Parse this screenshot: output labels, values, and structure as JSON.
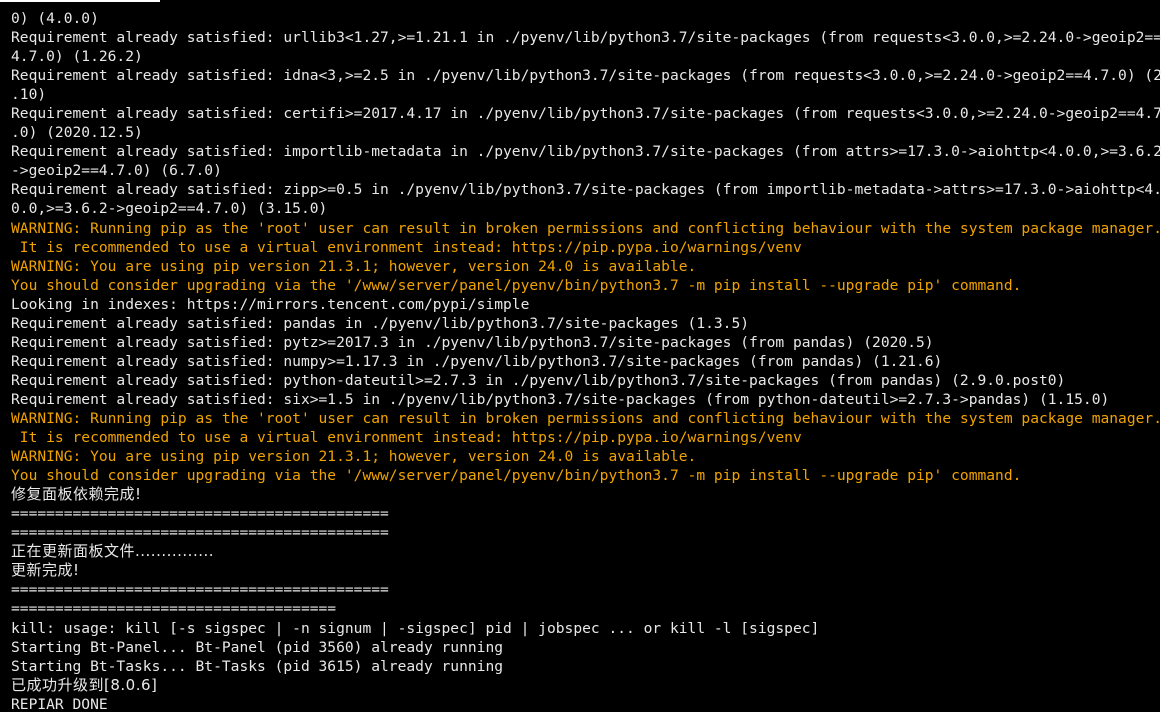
{
  "terminal": {
    "colors": {
      "background": "#000000",
      "text": "#e8e8e8",
      "warning": "#f0a300"
    },
    "lines": [
      {
        "text": "0) (4.0.0)",
        "kind": "normal"
      },
      {
        "text": "Requirement already satisfied: urllib3<1.27,>=1.21.1 in ./pyenv/lib/python3.7/site-packages (from requests<3.0.0,>=2.24.0->geoip2==",
        "kind": "normal"
      },
      {
        "text": "4.7.0) (1.26.2)",
        "kind": "normal"
      },
      {
        "text": "Requirement already satisfied: idna<3,>=2.5 in ./pyenv/lib/python3.7/site-packages (from requests<3.0.0,>=2.24.0->geoip2==4.7.0) (2",
        "kind": "normal"
      },
      {
        "text": ".10)",
        "kind": "normal"
      },
      {
        "text": "Requirement already satisfied: certifi>=2017.4.17 in ./pyenv/lib/python3.7/site-packages (from requests<3.0.0,>=2.24.0->geoip2==4.7",
        "kind": "normal"
      },
      {
        "text": ".0) (2020.12.5)",
        "kind": "normal"
      },
      {
        "text": "Requirement already satisfied: importlib-metadata in ./pyenv/lib/python3.7/site-packages (from attrs>=17.3.0->aiohttp<4.0.0,>=3.6.2",
        "kind": "normal"
      },
      {
        "text": "->geoip2==4.7.0) (6.7.0)",
        "kind": "normal"
      },
      {
        "text": "Requirement already satisfied: zipp>=0.5 in ./pyenv/lib/python3.7/site-packages (from importlib-metadata->attrs>=17.3.0->aiohttp<4.",
        "kind": "normal"
      },
      {
        "text": "0.0,>=3.6.2->geoip2==4.7.0) (3.15.0)",
        "kind": "normal"
      },
      {
        "text": "WARNING: Running pip as the 'root' user can result in broken permissions and conflicting behaviour with the system package manager.",
        "kind": "warn"
      },
      {
        "text": " It is recommended to use a virtual environment instead: https://pip.pypa.io/warnings/venv",
        "kind": "warn"
      },
      {
        "text": "WARNING: You are using pip version 21.3.1; however, version 24.0 is available.",
        "kind": "warn"
      },
      {
        "text": "You should consider upgrading via the '/www/server/panel/pyenv/bin/python3.7 -m pip install --upgrade pip' command.",
        "kind": "warn"
      },
      {
        "text": "Looking in indexes: https://mirrors.tencent.com/pypi/simple",
        "kind": "normal"
      },
      {
        "text": "Requirement already satisfied: pandas in ./pyenv/lib/python3.7/site-packages (1.3.5)",
        "kind": "normal"
      },
      {
        "text": "Requirement already satisfied: pytz>=2017.3 in ./pyenv/lib/python3.7/site-packages (from pandas) (2020.5)",
        "kind": "normal"
      },
      {
        "text": "Requirement already satisfied: numpy>=1.17.3 in ./pyenv/lib/python3.7/site-packages (from pandas) (1.21.6)",
        "kind": "normal"
      },
      {
        "text": "Requirement already satisfied: python-dateutil>=2.7.3 in ./pyenv/lib/python3.7/site-packages (from pandas) (2.9.0.post0)",
        "kind": "normal"
      },
      {
        "text": "Requirement already satisfied: six>=1.5 in ./pyenv/lib/python3.7/site-packages (from python-dateutil>=2.7.3->pandas) (1.15.0)",
        "kind": "normal"
      },
      {
        "text": "WARNING: Running pip as the 'root' user can result in broken permissions and conflicting behaviour with the system package manager.",
        "kind": "warn"
      },
      {
        "text": " It is recommended to use a virtual environment instead: https://pip.pypa.io/warnings/venv",
        "kind": "warn"
      },
      {
        "text": "WARNING: You are using pip version 21.3.1; however, version 24.0 is available.",
        "kind": "warn"
      },
      {
        "text": "You should consider upgrading via the '/www/server/panel/pyenv/bin/python3.7 -m pip install --upgrade pip' command.",
        "kind": "warn"
      },
      {
        "text": "修复面板依赖完成!",
        "kind": "cjk"
      },
      {
        "text": "===========================================",
        "kind": "normal"
      },
      {
        "text": "===========================================",
        "kind": "normal"
      },
      {
        "text": "正在更新面板文件...............",
        "kind": "cjk"
      },
      {
        "text": "更新完成!",
        "kind": "cjk"
      },
      {
        "text": "===========================================",
        "kind": "normal"
      },
      {
        "text": "=====================================",
        "kind": "normal"
      },
      {
        "text": "kill: usage: kill [-s sigspec | -n signum | -sigspec] pid | jobspec ... or kill -l [sigspec]",
        "kind": "normal"
      },
      {
        "text": "Starting Bt-Panel... Bt-Panel (pid 3560) already running",
        "kind": "normal"
      },
      {
        "text": "Starting Bt-Tasks... Bt-Tasks (pid 3615) already running",
        "kind": "normal"
      },
      {
        "text": "已成功升级到[8.0.6]",
        "kind": "cjk"
      },
      {
        "text": "REPIAR DONE",
        "kind": "normal"
      }
    ]
  }
}
